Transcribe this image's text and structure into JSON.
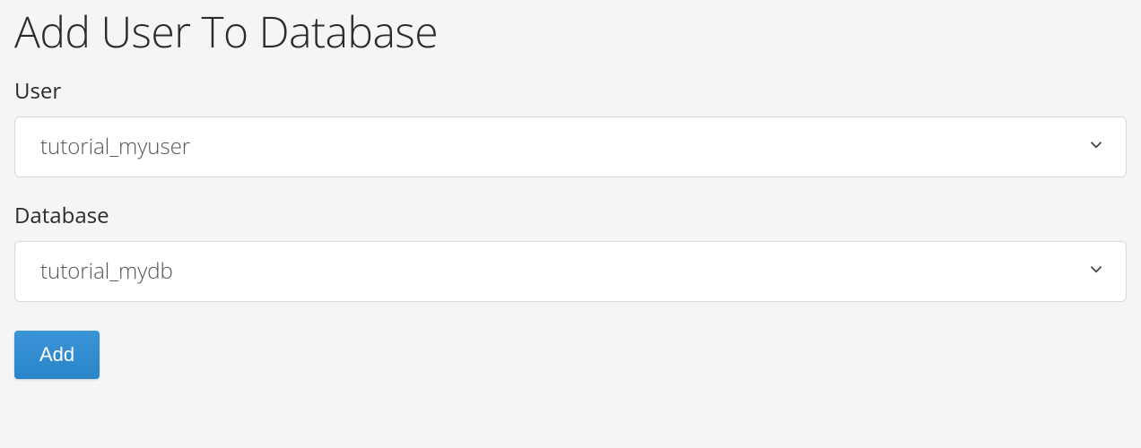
{
  "title": "Add User To Database",
  "form": {
    "user": {
      "label": "User",
      "selected": "tutorial_myuser"
    },
    "database": {
      "label": "Database",
      "selected": "tutorial_mydb"
    },
    "submit_label": "Add"
  }
}
